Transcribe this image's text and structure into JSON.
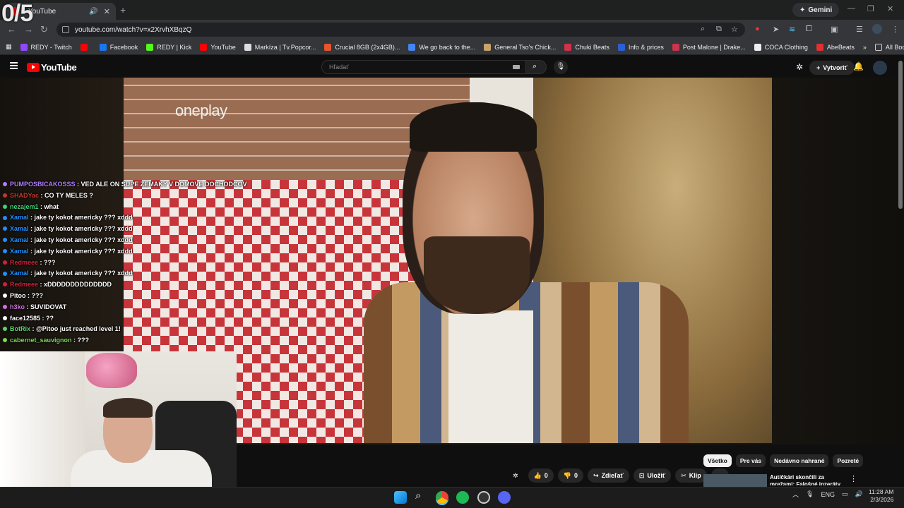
{
  "browser": {
    "tab_title": "- YouTube",
    "gemini_label": "Gemini",
    "url": "youtube.com/watch?v=x2XrvhXBqzQ",
    "all_bookmarks": "All Bookmarks",
    "bookmarks": [
      {
        "label": "REDY - Twitch",
        "color": "#9146ff"
      },
      {
        "label": "",
        "color": "#ff0000"
      },
      {
        "label": "Facebook",
        "color": "#1877f2"
      },
      {
        "label": "REDY | Kick",
        "color": "#53fc18"
      },
      {
        "label": "YouTube",
        "color": "#ff0000"
      },
      {
        "label": "Markíza | Tv.Popcor...",
        "color": "#dddddd"
      },
      {
        "label": "Crucial 8GB (2x4GB)...",
        "color": "#e8542b"
      },
      {
        "label": "We go back to the...",
        "color": "#4285f4"
      },
      {
        "label": "General Tso's Chick...",
        "color": "#c9a36a"
      },
      {
        "label": "Chuki Beats",
        "color": "#d0314b"
      },
      {
        "label": "Info & prices",
        "color": "#2b5fd9"
      },
      {
        "label": "Post Malone | Drake...",
        "color": "#d0314b"
      },
      {
        "label": "COCA Clothing",
        "color": "#eeeeee"
      },
      {
        "label": "AbeBeats",
        "color": "#e03030"
      }
    ]
  },
  "youtube": {
    "logo_text": "YouTube",
    "search_placeholder": "Hľadať",
    "create_label": "Vytvoriť",
    "video_brand": "oneplay",
    "actions": {
      "likes": "0",
      "dislikes": "0",
      "share": "Zdieľať",
      "save": "Uložiť",
      "clip": "Klip"
    },
    "chips": [
      "Všetko",
      "Pre vás",
      "Nedávno nahrané",
      "Pozreté"
    ],
    "recommended_title": "Autíčkári skončili za mrežami: Falošné inzeráty na internete..."
  },
  "chat": [
    {
      "user": "PUMPOSBICAKOSSS",
      "color": "#b07cff",
      "text": "VED ALE ON SUPE ZEMAKY V DOMOVE DOCHODCOV"
    },
    {
      "user": "SHADYac",
      "color": "#c0392b",
      "text": "CO TY MELES ?"
    },
    {
      "user": "nezajem1",
      "color": "#3fd17a",
      "text": "what"
    },
    {
      "user": "Xamal",
      "color": "#1e90ff",
      "text": "jake ty kokot americky ??? xddd"
    },
    {
      "user": "Xamal",
      "color": "#1e90ff",
      "text": "jake ty kokot americky ??? xddd"
    },
    {
      "user": "Xamal",
      "color": "#1e90ff",
      "text": "jake ty kokot americky ??? xddd"
    },
    {
      "user": "Xamal",
      "color": "#1e90ff",
      "text": "jake ty kokot americky ??? xddd"
    },
    {
      "user": "Redmeee",
      "color": "#d1213a",
      "text": "???"
    },
    {
      "user": "Xamal",
      "color": "#1e90ff",
      "text": "jake ty kokot americky ??? xddd"
    },
    {
      "user": "Redmeee",
      "color": "#d1213a",
      "text": "xDDDDDDDDDDDDDD"
    },
    {
      "user": "Pitoo",
      "color": "#ffffff",
      "text": "???"
    },
    {
      "user": "h3ko",
      "color": "#d46ee6",
      "text": "SUVIDOVAT"
    },
    {
      "user": "face12585",
      "color": "#ffffff",
      "text": "??"
    },
    {
      "user": "BotRix",
      "color": "#5fd36f",
      "text": "@Pitoo just reached level 1!"
    },
    {
      "user": "cabernet_sauvignon",
      "color": "#7ed957",
      "text": "???"
    }
  ],
  "taskbar": {
    "language": "ENG",
    "time": "11:28 AM",
    "date": "2/3/2026"
  },
  "overlay_counter": "0/5"
}
